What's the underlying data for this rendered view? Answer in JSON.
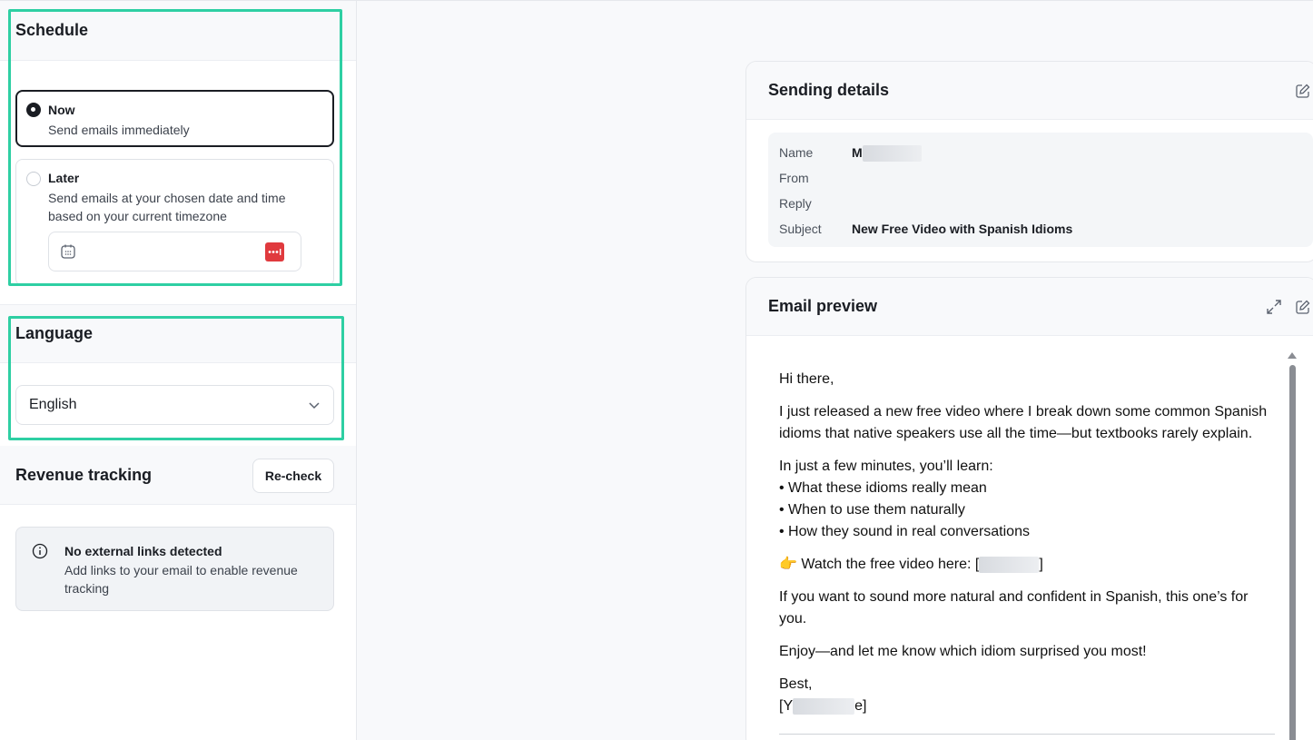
{
  "schedule": {
    "title": "Schedule",
    "options": [
      {
        "title": "Now",
        "description": "Send emails immediately",
        "selected": true
      },
      {
        "title": "Later",
        "description": "Send emails at your chosen date and time based on your current timezone",
        "selected": false
      }
    ]
  },
  "language": {
    "title": "Language",
    "selected": "English"
  },
  "revenue_tracking": {
    "title": "Revenue tracking",
    "recheck_label": "Re-check",
    "info_title": "No external links detected",
    "info_desc": "Add links to your email to enable revenue tracking"
  },
  "sending_details": {
    "title": "Sending details",
    "rows": [
      {
        "label": "Name",
        "value": "M"
      },
      {
        "label": "From",
        "value": ""
      },
      {
        "label": "Reply",
        "value": ""
      },
      {
        "label": "Subject",
        "value": "New Free Video with Spanish Idioms"
      }
    ]
  },
  "email_preview": {
    "title": "Email preview",
    "greeting": "Hi there,",
    "p1": "I just released a new free video where I break down some common Spanish idioms that native speakers use all the time—but textbooks rarely explain.",
    "p2_intro": "In just a few minutes, you’ll learn:",
    "bullets": [
      "• What these idioms really mean",
      "• When to use them naturally",
      "• How they sound in real conversations"
    ],
    "watch_emoji": "👉",
    "watch_text": "Watch the free video here: ",
    "watch_link_start": "[",
    "watch_link_end": "]",
    "p4": "If you want to sound more natural and confident in Spanish, this one’s for you.",
    "p5": "Enjoy—and let me know which idiom surprised you most!",
    "signoff": "Best,",
    "sig_start": "[Y",
    "sig_end": "e]"
  },
  "colors": {
    "highlight": "#2ecfa3",
    "password_manager_icon": "#e03a3e"
  }
}
